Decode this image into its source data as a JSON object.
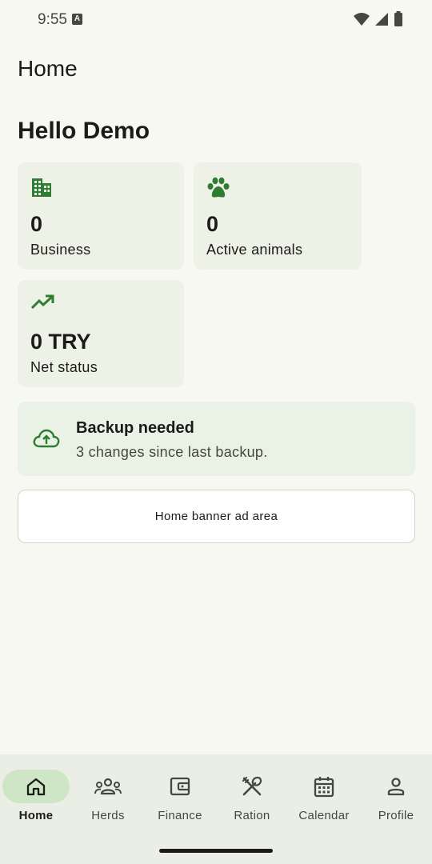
{
  "status_bar": {
    "time": "9:55",
    "notification_letter": "A"
  },
  "header": {
    "title": "Home"
  },
  "greeting": "Hello Demo",
  "stats": {
    "business": {
      "value": "0",
      "label": "Business",
      "icon": "business-icon"
    },
    "animals": {
      "value": "0",
      "label": "Active animals",
      "icon": "paw-icon"
    },
    "net": {
      "value": "0 TRY",
      "label": "Net status",
      "icon": "trending-up-icon"
    }
  },
  "backup": {
    "title": "Backup needed",
    "subtitle": "3 changes since last backup.",
    "icon": "cloud-upload-icon"
  },
  "ad_banner": {
    "text": "Home banner ad area"
  },
  "bottom_nav": {
    "items": [
      {
        "label": "Home",
        "icon": "home-icon",
        "active": true
      },
      {
        "label": "Herds",
        "icon": "groups-icon",
        "active": false
      },
      {
        "label": "Finance",
        "icon": "wallet-icon",
        "active": false
      },
      {
        "label": "Ration",
        "icon": "restaurant-icon",
        "active": false
      },
      {
        "label": "Calendar",
        "icon": "calendar-icon",
        "active": false
      },
      {
        "label": "Profile",
        "icon": "person-icon",
        "active": false
      }
    ]
  },
  "colors": {
    "accent_green": "#2e7d32",
    "background": "#f7f8f2",
    "card": "#eef2e6",
    "nav_active_pill": "#cfe6c6"
  }
}
